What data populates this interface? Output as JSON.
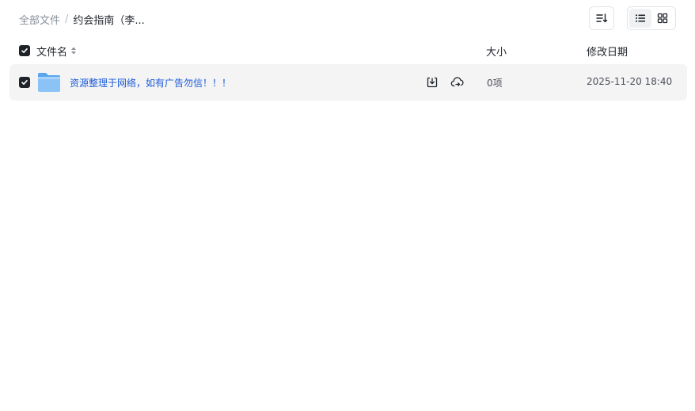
{
  "breadcrumb": {
    "root": "全部文件",
    "separator": "/",
    "current": "约会指南（李..."
  },
  "toolbar": {
    "sort_icon": "sort-icon",
    "view_list_icon": "list-view-icon",
    "view_grid_icon": "grid-view-icon",
    "active_view": "list"
  },
  "table": {
    "headers": {
      "name": "文件名",
      "size": "大小",
      "date": "修改日期"
    },
    "select_all_checked": true,
    "rows": [
      {
        "name": "资源整理于网络，如有广告勿信！！！",
        "type": "folder",
        "size": "0项",
        "date": "2025-11-20 18:40",
        "checked": true
      }
    ]
  },
  "colors": {
    "link": "#1c5bd6",
    "row_bg": "#f4f4f5",
    "checkbox": "#1f2329",
    "folder": "#7fbaf5"
  }
}
